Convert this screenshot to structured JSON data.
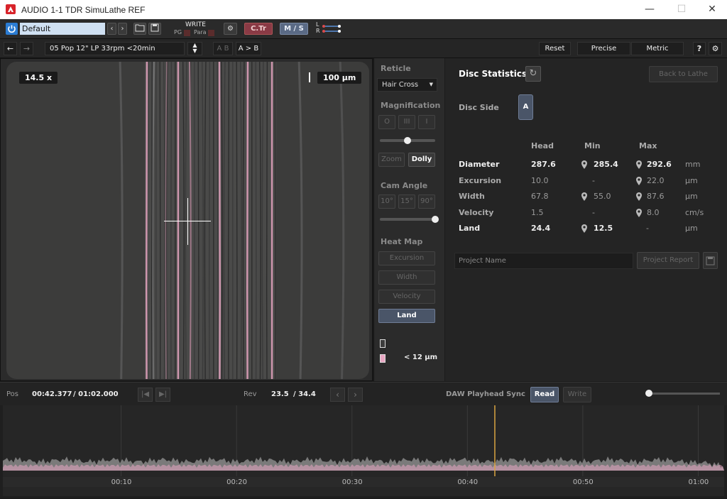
{
  "window": {
    "title": "AUDIO 1-1 TDR SimuLathe REF",
    "minimize": "—",
    "maximize": "☐",
    "close": "✕"
  },
  "toolbar": {
    "preset": "Default",
    "write_label": "WRITE",
    "pg_label": "PG",
    "para_label": "Para",
    "ctr_label": "C.Tr",
    "ms_label": "M / S",
    "l_label": "L",
    "r_label": "R"
  },
  "toolbar2": {
    "project": "05 Pop 12\" LP 33rpm <20min",
    "ab_label": "A B",
    "a_to_b_label": "A > B",
    "reset_label": "Reset",
    "precise_label": "Precise",
    "metric_label": "Metric",
    "help_label": "?"
  },
  "viewer": {
    "zoom": "14.5 x",
    "scale": "100 µm"
  },
  "controls": {
    "reticle_label": "Reticle",
    "reticle_value": "Hair Cross",
    "magnification_label": "Magnification",
    "mag_buttons": [
      "O",
      "III",
      "I"
    ],
    "zoom_label": "Zoom",
    "dolly_label": "Dolly",
    "cam_angle_label": "Cam Angle",
    "angles": [
      "10°",
      "15°",
      "90°"
    ],
    "heatmap_label": "Heat Map",
    "heatmap_buttons": [
      "Excursion",
      "Width",
      "Velocity",
      "Land"
    ],
    "legend_label": "< 12 µm",
    "magnification_level": 0.5,
    "cam_angle_level": 1.0
  },
  "stats": {
    "title": "Disc Statistics",
    "back_label": "Back to Lathe",
    "disc_side_label": "Disc Side",
    "disc_side_value": "A",
    "headers": [
      "Head",
      "Min",
      "Max"
    ],
    "rows": [
      {
        "label": "Diameter",
        "head": "287.6",
        "min": "285.4",
        "max": "292.6",
        "unit": "mm"
      },
      {
        "label": "Excursion",
        "head": "10.0",
        "min": "-",
        "max": "22.0",
        "unit": "µm"
      },
      {
        "label": "Width",
        "head": "67.8",
        "min": "55.0",
        "max": "87.6",
        "unit": "µm"
      },
      {
        "label": "Velocity",
        "head": "1.5",
        "min": "-",
        "max": "8.0",
        "unit": "cm/s"
      },
      {
        "label": "Land",
        "head": "24.4",
        "min": "12.5",
        "max": "-",
        "unit": "µm"
      }
    ],
    "project_placeholder": "Project Name",
    "report_label": "Project Report"
  },
  "transport": {
    "pos_label": "Pos",
    "pos_value": "00:42.377",
    "pos_total": "/ 01:02.000",
    "rev_label": "Rev",
    "rev_value": "23.5",
    "rev_total": "/ 34.4",
    "sync_label": "DAW Playhead Sync",
    "read_label": "Read",
    "write_label": "Write"
  },
  "timeline": {
    "ticks": [
      "00:10",
      "00:20",
      "00:30",
      "00:40",
      "00:50",
      "01:00"
    ],
    "total_seconds": 62,
    "playhead_seconds": 42.377
  },
  "colors": {
    "accent": "#4a5568",
    "groove_pink": "#e8a6c2",
    "playhead": "#d9a441",
    "power_blue": "#2b7cd3"
  }
}
